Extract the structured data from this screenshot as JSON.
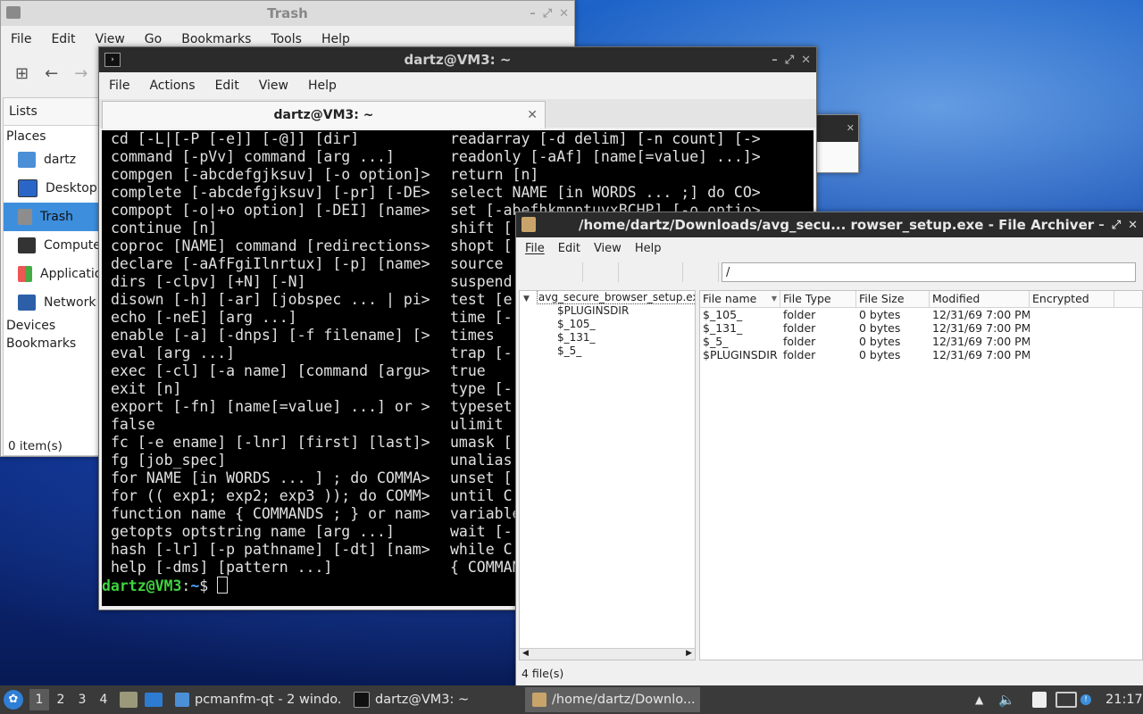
{
  "trash": {
    "title": "Trash",
    "menu": [
      "File",
      "Edit",
      "View",
      "Go",
      "Bookmarks",
      "Tools",
      "Help"
    ],
    "lists_label": "Lists",
    "places_label": "Places",
    "places": [
      "dartz",
      "Desktop",
      "Trash",
      "Computer",
      "Applications",
      "Network"
    ],
    "devices_label": "Devices",
    "bookmarks_label": "Bookmarks",
    "status": "0 item(s)"
  },
  "terminal": {
    "title": "dartz@VM3: ~",
    "menu": [
      "File",
      "Actions",
      "Edit",
      "View",
      "Help"
    ],
    "tab_label": "dartz@VM3: ~",
    "left_lines": [
      "cd [-L|[-P [-e]] [-@]] [dir]",
      "command [-pVv] command [arg ...]",
      "compgen [-abcdefgjksuv] [-o option]>",
      "complete [-abcdefgjksuv] [-pr] [-DE>",
      "compopt [-o|+o option] [-DEI] [name>",
      "continue [n]",
      "coproc [NAME] command [redirections>",
      "declare [-aAfFgiIlnrtux] [-p] [name>",
      "dirs [-clpv] [+N] [-N]",
      "disown [-h] [-ar] [jobspec ... | pi>",
      "echo [-neE] [arg ...]",
      "enable [-a] [-dnps] [-f filename] [>",
      "eval [arg ...]",
      "exec [-cl] [-a name] [command [argu>",
      "exit [n]",
      "export [-fn] [name[=value] ...] or >",
      "false",
      "fc [-e ename] [-lnr] [first] [last]>",
      "fg [job_spec]",
      "for NAME [in WORDS ... ] ; do COMMA>",
      "for (( exp1; exp2; exp3 )); do COMM>",
      "function name { COMMANDS ; } or nam>",
      "getopts optstring name [arg ...]",
      "hash [-lr] [-p pathname] [-dt] [nam>",
      "help [-dms] [pattern ...]"
    ],
    "right_lines": [
      "readarray [-d delim] [-n count] [->",
      "readonly [-aAf] [name[=value] ...]>",
      "return [n]",
      "select NAME [in WORDS ... ;] do CO>",
      "set [-abefhkmnptuvxBCHP] [-o optio>",
      "shift [",
      "shopt [",
      "source",
      "suspend",
      "test [e",
      "time [-",
      "times",
      "trap [-",
      "true",
      "type [-",
      "typeset",
      "ulimit",
      "umask [",
      "unalias",
      "unset [",
      "until C",
      "variable",
      "wait [-",
      "while C",
      "{ COMMAN"
    ],
    "prompt_user": "dartz@VM3",
    "prompt_sep": ":",
    "prompt_path": "~",
    "prompt_symbol": "$"
  },
  "archiver": {
    "title": "/home/dartz/Downloads/avg_secu... rowser_setup.exe - File Archiver",
    "menu": [
      "File",
      "Edit",
      "View",
      "Help"
    ],
    "path_value": "/",
    "tree_root": "avg_secure_browser_setup.exe",
    "tree_children": [
      "$PLUGINSDIR",
      "$_105_",
      "$_131_",
      "$_5_"
    ],
    "columns": [
      "File name",
      "File Type",
      "File Size",
      "Modified",
      "Encrypted"
    ],
    "rows": [
      [
        "$_105_",
        "folder",
        "0 bytes",
        "12/31/69 7:00 PM",
        ""
      ],
      [
        "$_131_",
        "folder",
        "0 bytes",
        "12/31/69 7:00 PM",
        ""
      ],
      [
        "$_5_",
        "folder",
        "0 bytes",
        "12/31/69 7:00 PM",
        ""
      ],
      [
        "$PLUGINSDIR",
        "folder",
        "0 bytes",
        "12/31/69 7:00 PM",
        ""
      ]
    ],
    "status": "4 file(s)"
  },
  "taskbar": {
    "desktops": [
      "1",
      "2",
      "3",
      "4"
    ],
    "tasks": [
      "pcmanfm-qt - 2 windo...",
      "dartz@VM3: ~",
      "/home/dartz/Downlo..."
    ],
    "clock": "21:17"
  },
  "colors": {
    "accent": "#3d8fde",
    "prompt_green": "#3ed43e",
    "prompt_blue": "#4fa3ff",
    "titlebar_dark": "#2b2b2b",
    "taskbar": "#3a3a3a"
  }
}
